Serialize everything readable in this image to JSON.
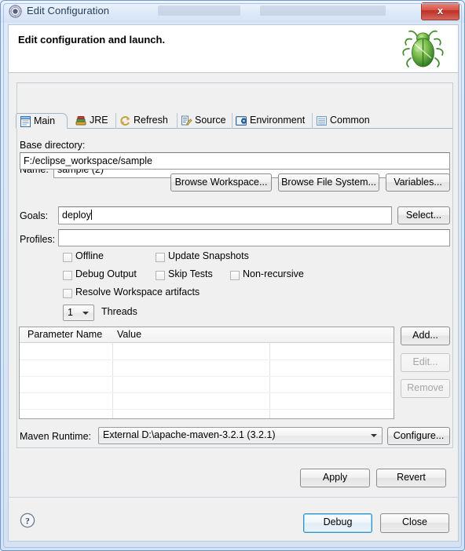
{
  "window": {
    "title": "Edit Configuration",
    "title_icon": "eclipse-config-icon",
    "close_label": "x"
  },
  "header": {
    "title": "Edit configuration and launch.",
    "icon": "green-bug-icon"
  },
  "form": {
    "name_label": "Name:",
    "name_value": "sample (2)",
    "base_directory_label": "Base directory:",
    "base_directory_value": "F:/eclipse_workspace/sample",
    "goals_label": "Goals:",
    "goals_value": "deploy",
    "profiles_label": "Profiles:",
    "profiles_value": "",
    "maven_runtime_label": "Maven Runtime:",
    "maven_runtime_value": "External D:\\apache-maven-3.2.1 (3.2.1)",
    "threads_value": "1",
    "threads_label": "Threads"
  },
  "tabs": [
    {
      "label": "Main",
      "icon": "main-page-icon",
      "selected": true
    },
    {
      "label": "JRE",
      "icon": "jre-icon",
      "selected": false
    },
    {
      "label": "Refresh",
      "icon": "refresh-icon",
      "selected": false
    },
    {
      "label": "Source",
      "icon": "source-icon",
      "selected": false
    },
    {
      "label": "Environment",
      "icon": "environment-icon",
      "selected": false
    },
    {
      "label": "Common",
      "icon": "common-icon",
      "selected": false
    }
  ],
  "buttons": {
    "browse_workspace": "Browse Workspace...",
    "browse_file_system": "Browse File System...",
    "variables": "Variables...",
    "select": "Select...",
    "add": "Add...",
    "edit": "Edit...",
    "remove": "Remove",
    "configure": "Configure...",
    "apply": "Apply",
    "revert": "Revert",
    "debug": "Debug",
    "close": "Close"
  },
  "checkboxes": [
    {
      "label": "Offline",
      "checked": false
    },
    {
      "label": "Update Snapshots",
      "checked": false
    },
    {
      "label": "Debug Output",
      "checked": false
    },
    {
      "label": "Skip Tests",
      "checked": false
    },
    {
      "label": "Non-recursive",
      "checked": false
    },
    {
      "label": "Resolve Workspace artifacts",
      "checked": false
    }
  ],
  "parameter_table": {
    "columns": [
      "Parameter Name",
      "Value",
      ""
    ],
    "rows": []
  },
  "colors": {
    "accent": "#2f93c8",
    "close_red": "#d9544a",
    "dialog_bg": "#f0f0f0",
    "frame_blue": "#6c9bd2"
  }
}
